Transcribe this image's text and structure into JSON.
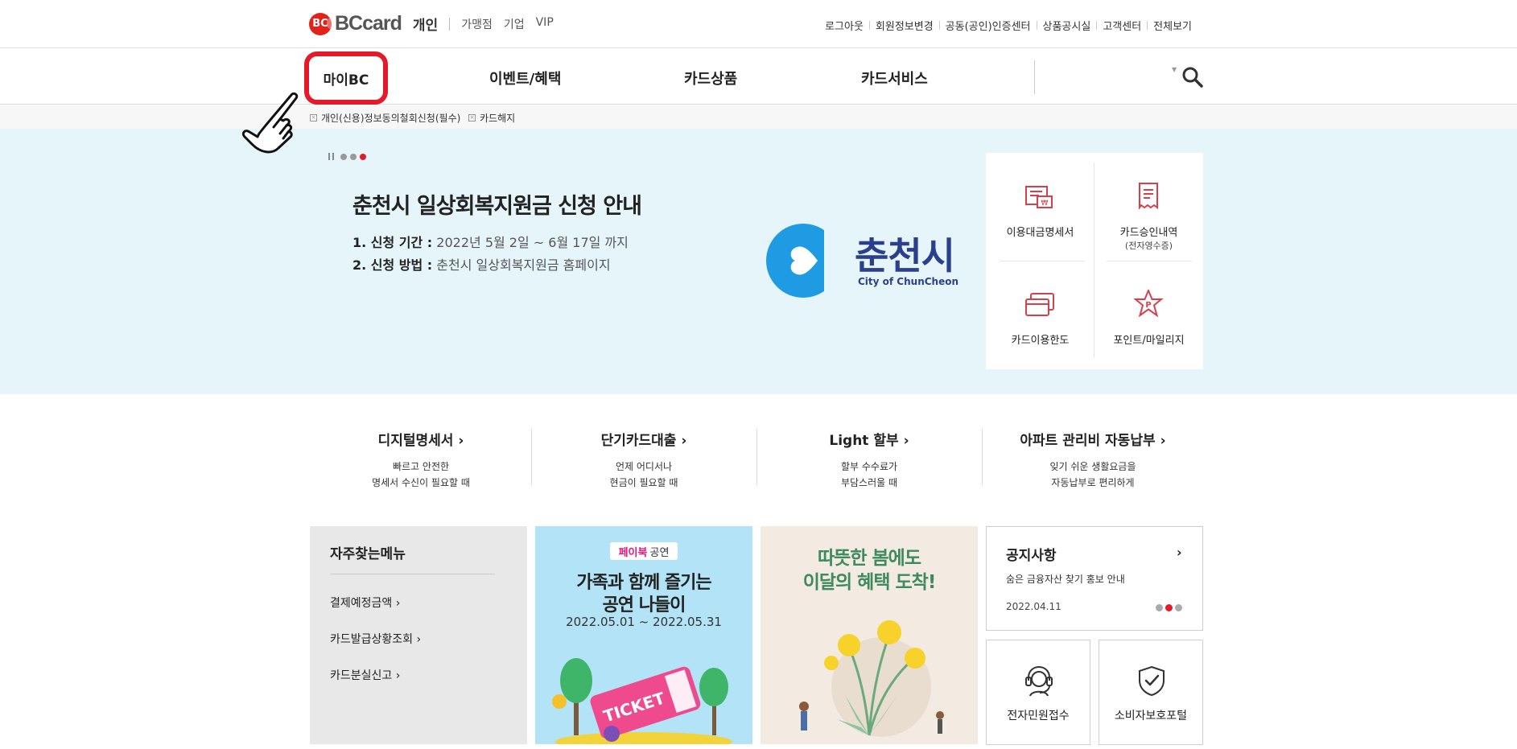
{
  "brand": {
    "logo_mark": "BC",
    "logo_text": "BCcard",
    "section": "개인",
    "links": [
      "가맹점",
      "기업",
      "VIP"
    ]
  },
  "util_links": [
    "로그아웃",
    "회원정보변경",
    "공동(공인)인증센터",
    "상품공시실",
    "고객센터",
    "전체보기"
  ],
  "gnb": {
    "items": [
      "마이BC",
      "이벤트/혜택",
      "카드상품",
      "카드서비스"
    ]
  },
  "sub_links": [
    "개인(신용)정보동의철회신청(필수)",
    "카드해지"
  ],
  "hero": {
    "title": "춘천시 일상회복지원금 신청 안내",
    "line1_label": "1. 신청 기간 :",
    "line1_value": " 2022년 5월 2일 ~ 6월 17일 까지",
    "line2_label": "2. 신청 방법 :",
    "line2_value": " 춘천시 일상회복지원금 홈페이지",
    "city_name": "춘천시",
    "city_sub": "City of ChunCheon",
    "slide_count": 3,
    "active_slide": 3
  },
  "quick_menu": [
    {
      "label": "이용대금명세서",
      "sub": "",
      "icon": "bill-icon"
    },
    {
      "label": "카드승인내역",
      "sub": "(전자영수증)",
      "icon": "receipt-icon"
    },
    {
      "label": "카드이용한도",
      "sub": "",
      "icon": "card-icon"
    },
    {
      "label": "포인트/마일리지",
      "sub": "",
      "icon": "point-star-icon"
    }
  ],
  "services": [
    {
      "title": "디지털명세서",
      "desc1": "빠르고 안전한",
      "desc2": "명세서 수신이 필요할 때"
    },
    {
      "title": "단기카드대출",
      "desc1": "언제 어디서나",
      "desc2": "현금이 필요할 때"
    },
    {
      "title": "Light 할부",
      "desc1": "할부 수수료가",
      "desc2": "부담스러울 때"
    },
    {
      "title": "아파트 관리비 자동납부",
      "desc1": "잊기 쉬운 생활요금을",
      "desc2": "자동납부로 편리하게"
    }
  ],
  "frequent_menu": {
    "title": "자주찾는메뉴",
    "items": [
      "결제예정금액",
      "카드발급상황조회",
      "카드분실신고"
    ]
  },
  "promo1": {
    "badge_a": "페이북",
    "badge_b": "공연",
    "title1": "가족과 함께 즐기는",
    "title2": "공연 나들이",
    "date": "2022.05.01 ~ 2022.05.31",
    "ticket_text": "TICKET"
  },
  "promo2": {
    "title1": "따뜻한 봄에도",
    "title2": "이달의 혜택 도착!"
  },
  "notice": {
    "title": "공지사항",
    "text": "숨은 금융자산 찾기 홍보 안내",
    "date": "2022.04.11",
    "page_count": 3,
    "active_page": 2
  },
  "small_cards": [
    {
      "label": "전자민원접수",
      "icon": "headset-icon"
    },
    {
      "label": "소비자보호포털",
      "icon": "shield-check-icon"
    }
  ],
  "colors": {
    "accent_red": "#e41a2b",
    "hero_bg": "#e6f5fa",
    "city_blue": "#2b3f8f",
    "city_logo_blue": "#1e9be3",
    "promo2_green": "#3c8a5e"
  }
}
